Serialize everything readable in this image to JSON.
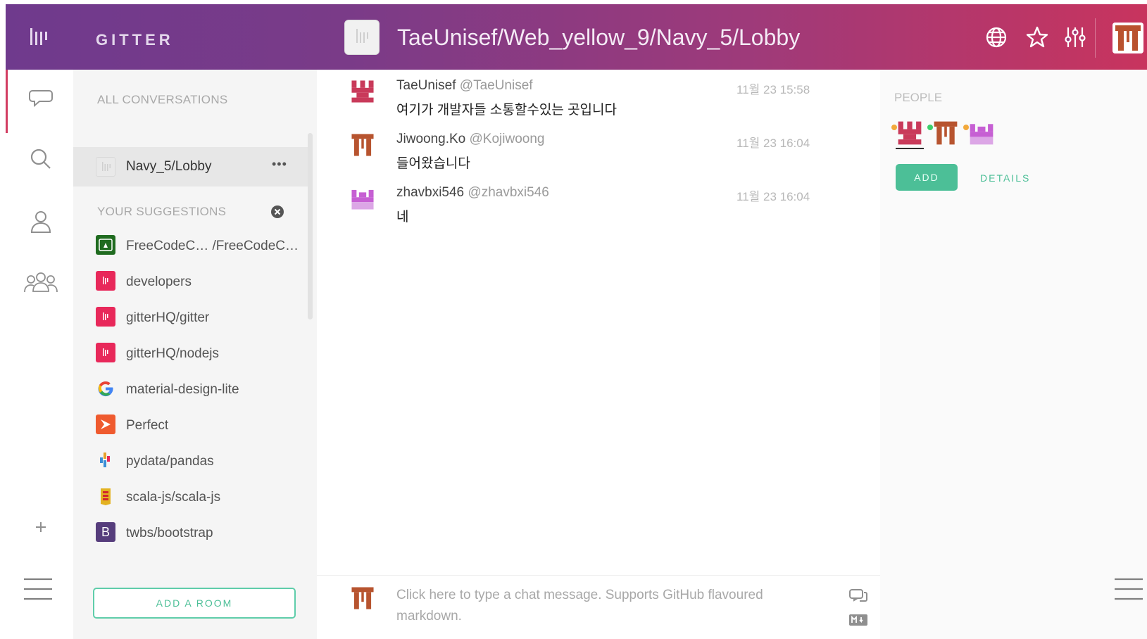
{
  "header": {
    "brand": "GITTER",
    "room_title": "TaeUnisef/Web_yellow_9/Navy_5/Lobby",
    "icons": [
      "globe-icon",
      "star-icon",
      "settings-sliders-icon"
    ]
  },
  "rail": {
    "icons": [
      "chat-bubble-icon",
      "search-icon",
      "person-icon",
      "group-icon",
      "plus-icon",
      "menu-icon"
    ]
  },
  "sidebar": {
    "all_conversations": "ALL CONVERSATIONS",
    "active_room": "Navy_5/Lobby",
    "active_room_more": "•••",
    "suggestions_heading": "YOUR SUGGESTIONS",
    "suggestions": [
      {
        "name": "FreeCodeC… /FreeCodeC…",
        "icon": "freecodecamp-icon",
        "color": "#1f6b1f"
      },
      {
        "name": "developers",
        "icon": "gitter-icon",
        "color": "#e8285a"
      },
      {
        "name": "gitterHQ/gitter",
        "icon": "gitter-icon",
        "color": "#e8285a"
      },
      {
        "name": "gitterHQ/nodejs",
        "icon": "gitter-icon",
        "color": "#e8285a"
      },
      {
        "name": "material-design-lite",
        "icon": "google-icon",
        "color": "#4285f4"
      },
      {
        "name": "Perfect",
        "icon": "perfect-icon",
        "color": "#ef5a2e"
      },
      {
        "name": "pydata/pandas",
        "icon": "pandas-icon",
        "color": "#e6a12b"
      },
      {
        "name": "scala-js/scala-js",
        "icon": "scala-icon",
        "color": "#e3b221"
      },
      {
        "name": "twbs/bootstrap",
        "icon": "bootstrap-icon",
        "color": "#563d7c"
      }
    ],
    "add_room": "ADD A ROOM"
  },
  "chat": {
    "messages": [
      {
        "name": "TaeUnisef",
        "username": "@TaeUnisef",
        "time": "11월 23 15:58",
        "text": "여기가 개발자들 소통할수있는 곳입니다",
        "avatar_color": "#c93a5a"
      },
      {
        "name": "Jiwoong.Ko",
        "username": "@Kojiwoong",
        "time": "11월 23 16:04",
        "text": "들어왔습니다",
        "avatar_color": "#b7542f"
      },
      {
        "name": "zhavbxi546",
        "username": "@zhavbxi546",
        "time": "11월 23 16:04",
        "text": "네",
        "avatar_color": "#c65fd3"
      }
    ],
    "composer_placeholder": "Click here to type a chat message. Supports GitHub flavoured markdown."
  },
  "people": {
    "heading": "PEOPLE",
    "add": "ADD",
    "details": "DETAILS",
    "statuses": [
      "#f2a93b",
      "#3ccf6a",
      "#f2a93b"
    ]
  }
}
